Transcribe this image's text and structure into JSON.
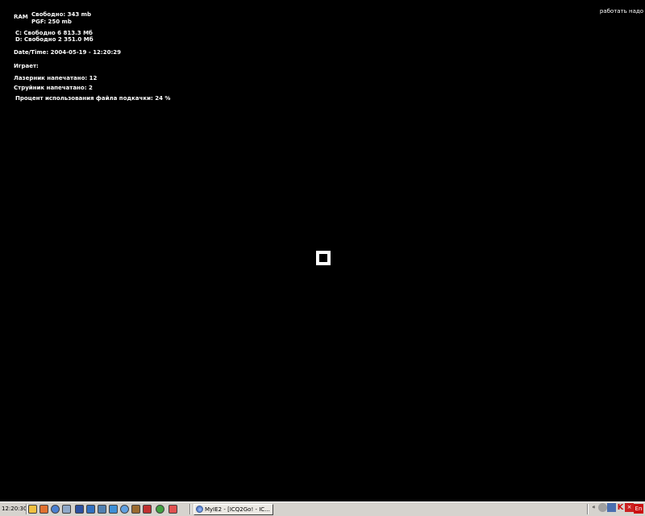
{
  "overlay": {
    "ram_label": "RAM",
    "ram_free": "Свободно: 343 mb",
    "ram_pgf": "PGF: 250 mb",
    "disk_c": "C: Свободно 6 813.3 Мб",
    "disk_d": "D: Свободно 2 351.0 Мб",
    "datetime": "Date/Time: 2004-05-19 - 12:20:29",
    "playing": "Играет:",
    "laser_printed": "Лазерник напечатано: 12",
    "jet_printed": "Струйник напечатано: 2",
    "pagefile_usage": "Процент использования файла подкачки: 24 %",
    "work_needed": "работать надо"
  },
  "taskbar": {
    "clock": "12:20:30",
    "task_button_label": "MyIE2 - [ICQ2Go! - IC...",
    "language": "En",
    "colors": {
      "taskbar_bg": "#d6d3ce",
      "lang_bg": "#cc1010"
    }
  },
  "quick_launch": [
    "folder-icon",
    "app-icon",
    "browser-icon",
    "network-icon",
    "notepad-icon",
    "pen-icon",
    "monitor-icon",
    "media-icon",
    "globe-icon",
    "printer-icon",
    "paint-icon",
    "refresh-icon",
    "help-icon"
  ],
  "tray_icons": [
    "rewind-icon",
    "clock-icon",
    "camera-icon",
    "kaspersky-icon",
    "close-icon"
  ]
}
